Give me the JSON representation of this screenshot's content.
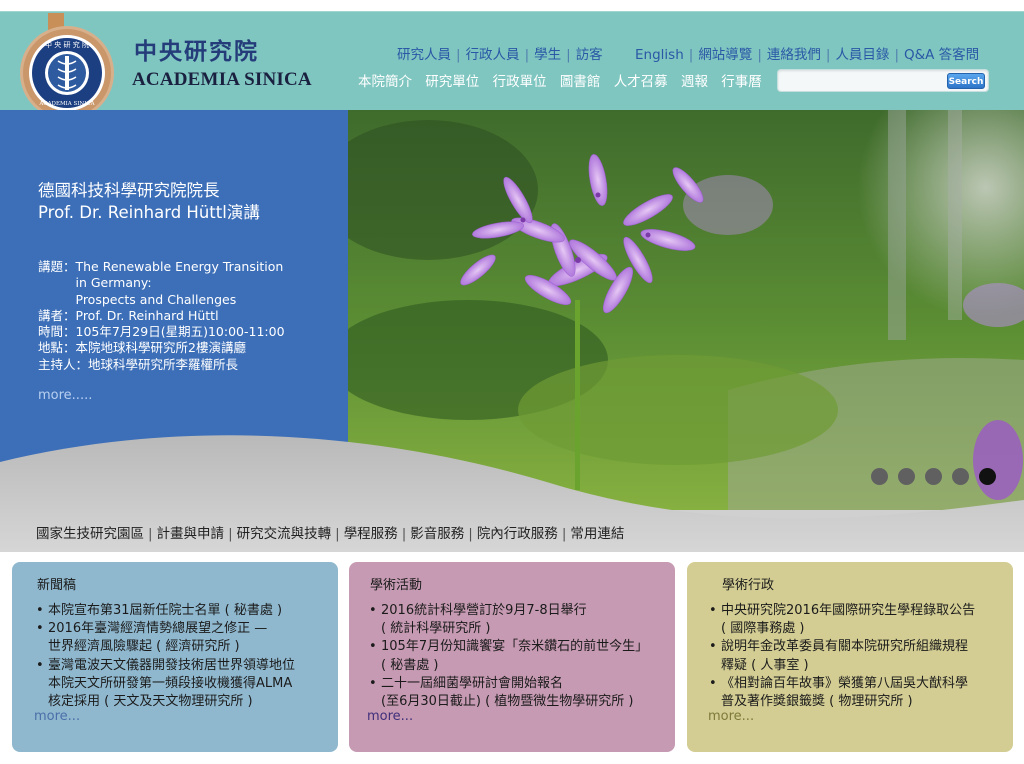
{
  "header": {
    "seal_text": "中央研究院 ACADEMIA SINICA",
    "brand_zh": "中央研究院",
    "brand_en": "ACADEMIA SINICA",
    "audience_links": [
      "研究人員",
      "行政人員",
      "學生",
      "訪客"
    ],
    "util_links": [
      "English",
      "網站導覽",
      "連絡我們",
      "人員目錄",
      "Q&A 答客問"
    ],
    "main_nav": [
      "本院簡介",
      "研究單位",
      "行政單位",
      "圖書館",
      "人才召募",
      "週報",
      "行事曆"
    ],
    "search": {
      "value": "",
      "button_label": "Search"
    }
  },
  "banner": {
    "title_lines": [
      "德國科技科學研究院院長",
      "Prof. Dr. Reinhard Hüttl演講"
    ],
    "details": [
      "講題：The Renewable Energy Transition",
      "　　　in Germany:",
      "　　　Prospects and Challenges",
      "講者：Prof. Dr. Reinhard Hüttl",
      "時間：105年7月29日(星期五)10:00-11:00",
      "地點：本院地球科學研究所2樓演講廳",
      "主持人：地球科學研究所李羅權所長"
    ],
    "more": "more.....",
    "slide_count": 5,
    "active_slide": 5,
    "sub_nav": [
      "國家生技研究園區",
      "計畫與申請",
      "研究交流與技轉",
      "學程服務",
      "影音服務",
      "院內行政服務",
      "常用連結"
    ]
  },
  "boxes": {
    "news": {
      "title": "新聞稿",
      "items": [
        [
          "本院宣布第31屆新任院士名單 ( 秘書處 )"
        ],
        [
          "2016年臺灣經濟情勢總展望之修正 —",
          "世界經濟風險驟起 ( 經濟研究所 )"
        ],
        [
          "臺灣電波天文儀器開發技術居世界領導地位",
          "本院天文所研發第一頻段接收機獲得ALMA",
          "核定採用 ( 天文及天文物理研究所 )"
        ]
      ],
      "more": "more..."
    },
    "academic": {
      "title": "學術活動",
      "items": [
        [
          "2016統計科學營訂於9月7-8日舉行",
          "( 統計科學研究所 )"
        ],
        [
          "105年7月份知識饗宴「奈米鑽石的前世今生」",
          "( 秘書處 )"
        ],
        [
          "二十一屆細菌學研討會開始報名",
          "(至6月30日截止) ( 植物暨微生物學研究所 )"
        ]
      ],
      "more": "more..."
    },
    "admin": {
      "title": "學術行政",
      "items": [
        [
          "中央研究院2016年國際研究生學程錄取公告",
          "( 國際事務處 )"
        ],
        [
          "說明年金改革委員有關本院研究所組織規程",
          "釋疑 ( 人事室 )"
        ],
        [
          "《相對論百年故事》榮獲第八屆吳大猷科學",
          "普及著作獎銀籤獎 ( 物理研究所 )"
        ]
      ],
      "more": "more..."
    }
  },
  "colors": {
    "header_bg": "#80c6c0",
    "feature_bg": "#3d6fb8",
    "news_bg": "#8fb8cf",
    "academic_bg": "#c69ab2",
    "admin_bg": "#d3cd93"
  }
}
